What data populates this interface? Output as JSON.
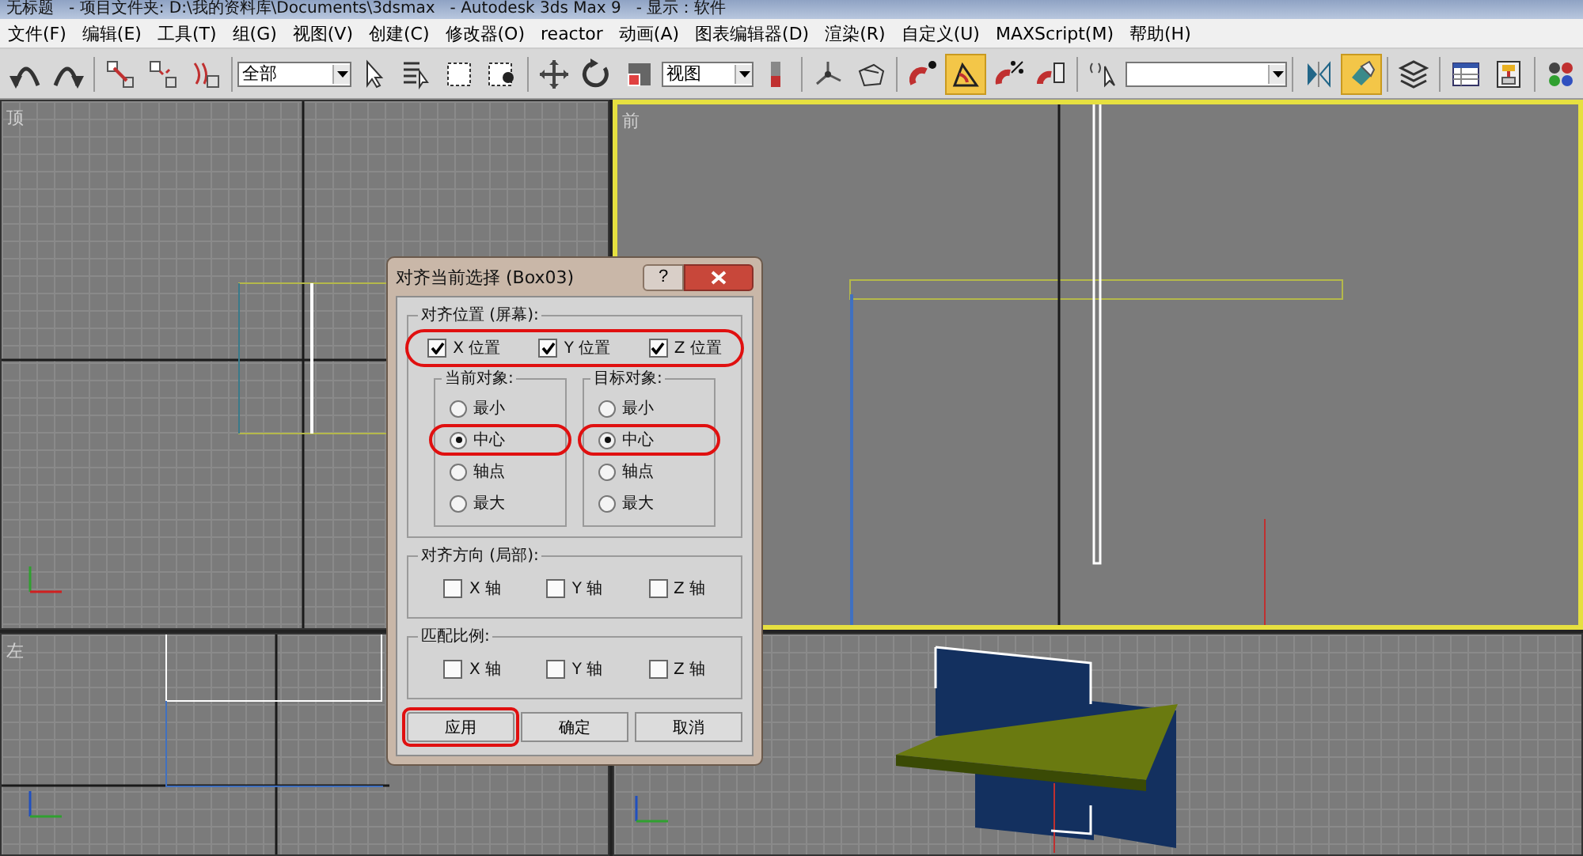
{
  "title_bar": {
    "text": "无标题   - 项目文件夹: D:\\我的资料库\\Documents\\3dsmax   - Autodesk 3ds Max 9   - 显示：软件"
  },
  "menu": [
    "文件(F)",
    "编辑(E)",
    "工具(T)",
    "组(G)",
    "视图(V)",
    "创建(C)",
    "修改器(O)",
    "reactor",
    "动画(A)",
    "图表编辑器(D)",
    "渲染(R)",
    "自定义(U)",
    "MAXScript(M)",
    "帮助(H)"
  ],
  "toolbar": [
    {
      "kind": "button",
      "active": false
    },
    {
      "kind": "button",
      "active": false
    },
    {
      "kind": "separator"
    },
    {
      "kind": "button",
      "active": false
    },
    {
      "kind": "button",
      "active": false
    },
    {
      "kind": "button",
      "active": false
    },
    {
      "kind": "separator"
    },
    {
      "kind": "dropdown",
      "value": "全部"
    },
    {
      "kind": "button",
      "active": false
    },
    {
      "kind": "button",
      "active": false
    },
    {
      "kind": "button",
      "active": false
    },
    {
      "kind": "button",
      "active": false
    },
    {
      "kind": "separator"
    },
    {
      "kind": "button",
      "active": false
    },
    {
      "kind": "button",
      "active": false
    },
    {
      "kind": "button",
      "active": false
    },
    {
      "kind": "dropdown",
      "value": "视图"
    },
    {
      "kind": "button",
      "active": false
    },
    {
      "kind": "separator"
    },
    {
      "kind": "button",
      "active": false
    },
    {
      "kind": "button",
      "active": false
    },
    {
      "kind": "separator"
    },
    {
      "kind": "button",
      "active": false
    },
    {
      "kind": "button",
      "active": true
    },
    {
      "kind": "button",
      "active": false
    },
    {
      "kind": "button",
      "active": false
    },
    {
      "kind": "separator"
    },
    {
      "kind": "button",
      "active": false
    },
    {
      "kind": "dropdown"
    },
    {
      "kind": "separator"
    },
    {
      "kind": "button",
      "active": false
    },
    {
      "kind": "button",
      "active": true
    },
    {
      "kind": "separator"
    },
    {
      "kind": "button",
      "active": false
    },
    {
      "kind": "separator"
    },
    {
      "kind": "button",
      "active": false
    },
    {
      "kind": "button",
      "active": false
    },
    {
      "kind": "separator"
    },
    {
      "kind": "button",
      "active": false
    }
  ],
  "viewports": [
    {
      "kind": "top",
      "label": "顶",
      "active": false
    },
    {
      "kind": "front",
      "label": "前",
      "active": true
    },
    {
      "kind": "left",
      "label": "左",
      "active": false
    },
    {
      "kind": "perspective",
      "active": false
    }
  ],
  "dialog": {
    "title": "对齐当前选择 (Box03)",
    "help": "?",
    "align_position": {
      "title": "对齐位置 (屏幕):",
      "circled": true,
      "checks": [
        {
          "label": "X 位置",
          "checked": true
        },
        {
          "label": "Y 位置",
          "checked": true
        },
        {
          "label": "Z 位置",
          "checked": true
        }
      ]
    },
    "current_object": {
      "title": "当前对象:",
      "options": [
        {
          "label": "最小",
          "selected": false,
          "circled": false
        },
        {
          "label": "中心",
          "selected": true,
          "circled": true
        },
        {
          "label": "轴点",
          "selected": false,
          "circled": false
        },
        {
          "label": "最大",
          "selected": false,
          "circled": false
        }
      ]
    },
    "target_object": {
      "title": "目标对象:",
      "options": [
        {
          "label": "最小",
          "selected": false,
          "circled": false
        },
        {
          "label": "中心",
          "selected": true,
          "circled": true
        },
        {
          "label": "轴点",
          "selected": false,
          "circled": false
        },
        {
          "label": "最大",
          "selected": false,
          "circled": false
        }
      ]
    },
    "align_orientation": {
      "title": "对齐方向 (局部):",
      "checks": [
        {
          "label": "X 轴",
          "checked": false
        },
        {
          "label": "Y 轴",
          "checked": false
        },
        {
          "label": "Z 轴",
          "checked": false
        }
      ]
    },
    "match_scale": {
      "title": "匹配比例:",
      "checks": [
        {
          "label": "X 轴",
          "checked": false
        },
        {
          "label": "Y 轴",
          "checked": false
        },
        {
          "label": "Z 轴",
          "checked": false
        }
      ]
    },
    "buttons": [
      {
        "label": "应用",
        "circled": true
      },
      {
        "label": "确定",
        "circled": false
      },
      {
        "label": "取消",
        "circled": false
      }
    ]
  }
}
